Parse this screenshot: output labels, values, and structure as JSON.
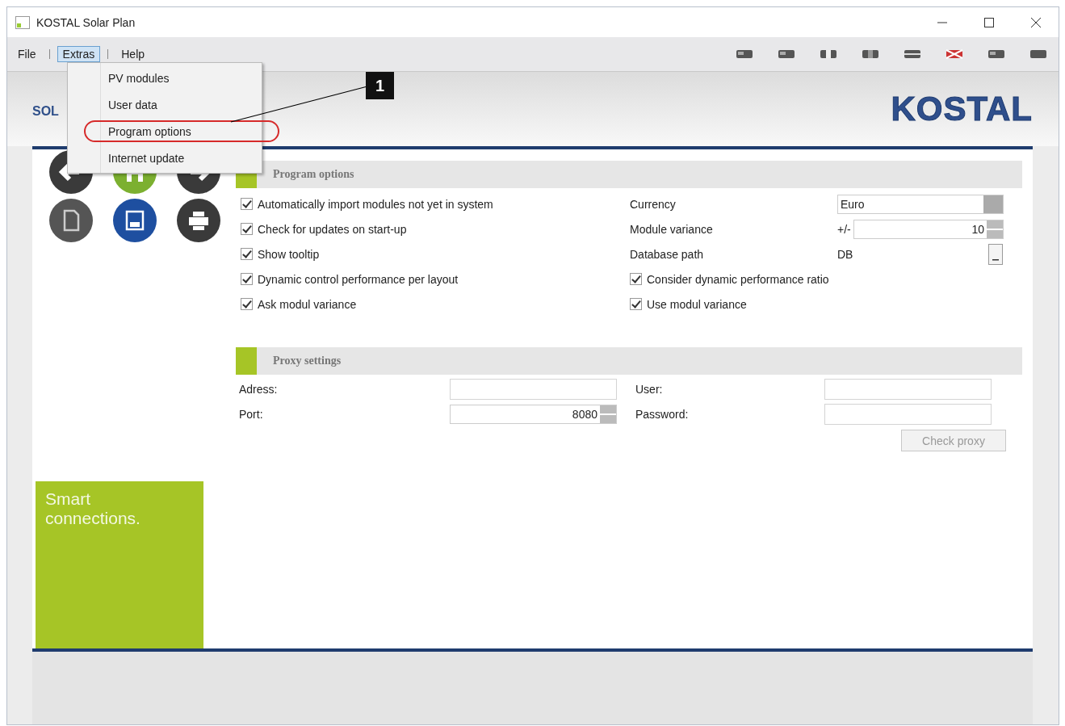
{
  "window": {
    "title": "KOSTAL Solar Plan"
  },
  "menu": [
    {
      "label": "File",
      "selected": false
    },
    {
      "label": "Extras",
      "selected": true
    },
    {
      "label": "Help",
      "selected": false
    }
  ],
  "dropdown": [
    {
      "label": "PV modules",
      "circled": false
    },
    {
      "label": "User data",
      "circled": false
    },
    {
      "label": "Program options",
      "circled": true
    },
    {
      "label": "Internet update",
      "circled": false
    }
  ],
  "callout": {
    "number": "1"
  },
  "header": {
    "title": "SOL",
    "logo": "KOSTAL"
  },
  "sidebar": {
    "slogan": "Smart connections."
  },
  "program_options": {
    "title": "Program options",
    "checkboxes_left": [
      {
        "label": "Automatically import modules not yet in system",
        "checked": true
      },
      {
        "label": "Check for updates on start-up",
        "checked": true
      },
      {
        "label": "Show tooltip",
        "checked": true
      },
      {
        "label": "Dynamic control performance per layout",
        "checked": true
      },
      {
        "label": "Ask modul variance",
        "checked": true
      }
    ],
    "currency": {
      "label": "Currency",
      "value": "Euro"
    },
    "module_variance": {
      "label": "Module variance",
      "prefix": "+/-",
      "value": "10"
    },
    "database_path": {
      "label": "Database path",
      "value": "DB"
    },
    "checkboxes_right": [
      {
        "label": "Consider dynamic performance ratio",
        "checked": true
      },
      {
        "label": "Use modul variance",
        "checked": true
      }
    ]
  },
  "proxy": {
    "title": "Proxy settings",
    "address": {
      "label": "Adress:"
    },
    "port": {
      "label": "Port:",
      "value": "8080"
    },
    "user": {
      "label": "User:"
    },
    "password": {
      "label": "Password:"
    },
    "button": {
      "label": "Check proxy",
      "disabled": true
    }
  }
}
